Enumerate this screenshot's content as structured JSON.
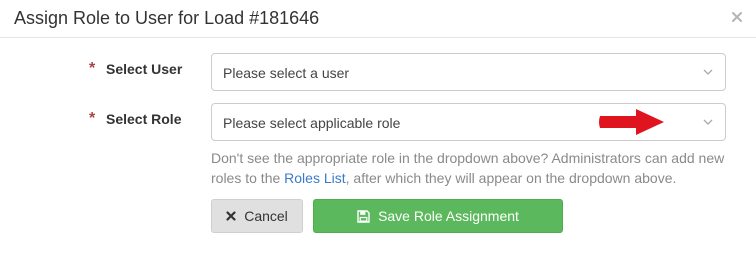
{
  "modal": {
    "title": "Assign Role to User for Load #181646",
    "close_glyph": "×"
  },
  "form": {
    "user": {
      "required_mark": "*",
      "label": "Select User",
      "selected_text": "Please select a user"
    },
    "role": {
      "required_mark": "*",
      "label": "Select Role",
      "selected_text": "Please select applicable role"
    },
    "help": {
      "text_before": "Don't see the appropriate role in the dropdown above? Administrators can add new roles to the ",
      "link_text": "Roles List",
      "text_after": ", after which they will appear on the dropdown above."
    }
  },
  "buttons": {
    "cancel_label": "Cancel",
    "save_label": "Save Role Assignment"
  },
  "icons": {
    "close": "close-icon",
    "chevron": "chevron-down-icon",
    "cancel": "times-icon",
    "save": "floppy-disk-icon",
    "annotation": "red-arrow-icon"
  },
  "colors": {
    "required": "#a94442",
    "save_button": "#5cb85c",
    "cancel_button": "#e0e0e0",
    "link": "#3a7bc8",
    "help_text": "#8a8a8a",
    "annotation_arrow": "#e0141e"
  }
}
